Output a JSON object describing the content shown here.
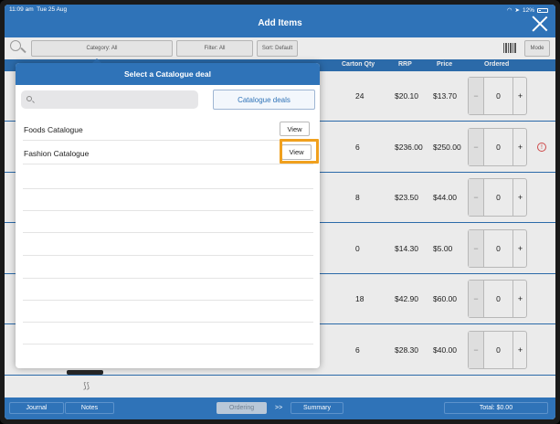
{
  "status_bar": {
    "time": "11:09 am",
    "date": "Tue 25 Aug",
    "battery": "12%"
  },
  "header": {
    "title": "Add Items"
  },
  "toolbar": {
    "category_label": "Category: All",
    "filter_label": "Filter: All",
    "sort_label": "Sort: Default",
    "mode_label": "Mode"
  },
  "columns": {
    "carton_qty": "Carton Qty",
    "rrp": "RRP",
    "price": "Price",
    "ordered": "Ordered"
  },
  "rows": [
    {
      "carton_qty": "24",
      "rrp": "$20.10",
      "price": "$13.70",
      "ordered": "0",
      "warning": false
    },
    {
      "carton_qty": "6",
      "rrp": "$236.00",
      "price": "$250.00",
      "ordered": "0",
      "warning": true
    },
    {
      "carton_qty": "8",
      "rrp": "$23.50",
      "price": "$44.00",
      "ordered": "0",
      "warning": false
    },
    {
      "carton_qty": "0",
      "rrp": "$14.30",
      "price": "$5.00",
      "ordered": "0",
      "warning": false
    },
    {
      "carton_qty": "18",
      "rrp": "$42.90",
      "price": "$60.00",
      "ordered": "0",
      "warning": false
    },
    {
      "carton_qty": "6",
      "rrp": "$28.30",
      "price": "$40.00",
      "ordered": "0",
      "warning": false
    }
  ],
  "stepper": {
    "minus": "−",
    "plus": "+"
  },
  "modal": {
    "title": "Select a Catalogue deal",
    "search_placeholder": "",
    "deals_button": "Catalogue deals",
    "catalogues": [
      {
        "name": "Foods Catalogue",
        "action": "View"
      },
      {
        "name": "Fashion Catalogue",
        "action": "View"
      }
    ]
  },
  "footer": {
    "journal": "Journal",
    "notes": "Notes",
    "ordering": "Ordering",
    "arrows": ">>",
    "summary": "Summary",
    "total": "Total: $0.00"
  },
  "colors": {
    "primary": "#2f73b8",
    "highlight": "#f0a01e",
    "warning": "#e05050"
  }
}
